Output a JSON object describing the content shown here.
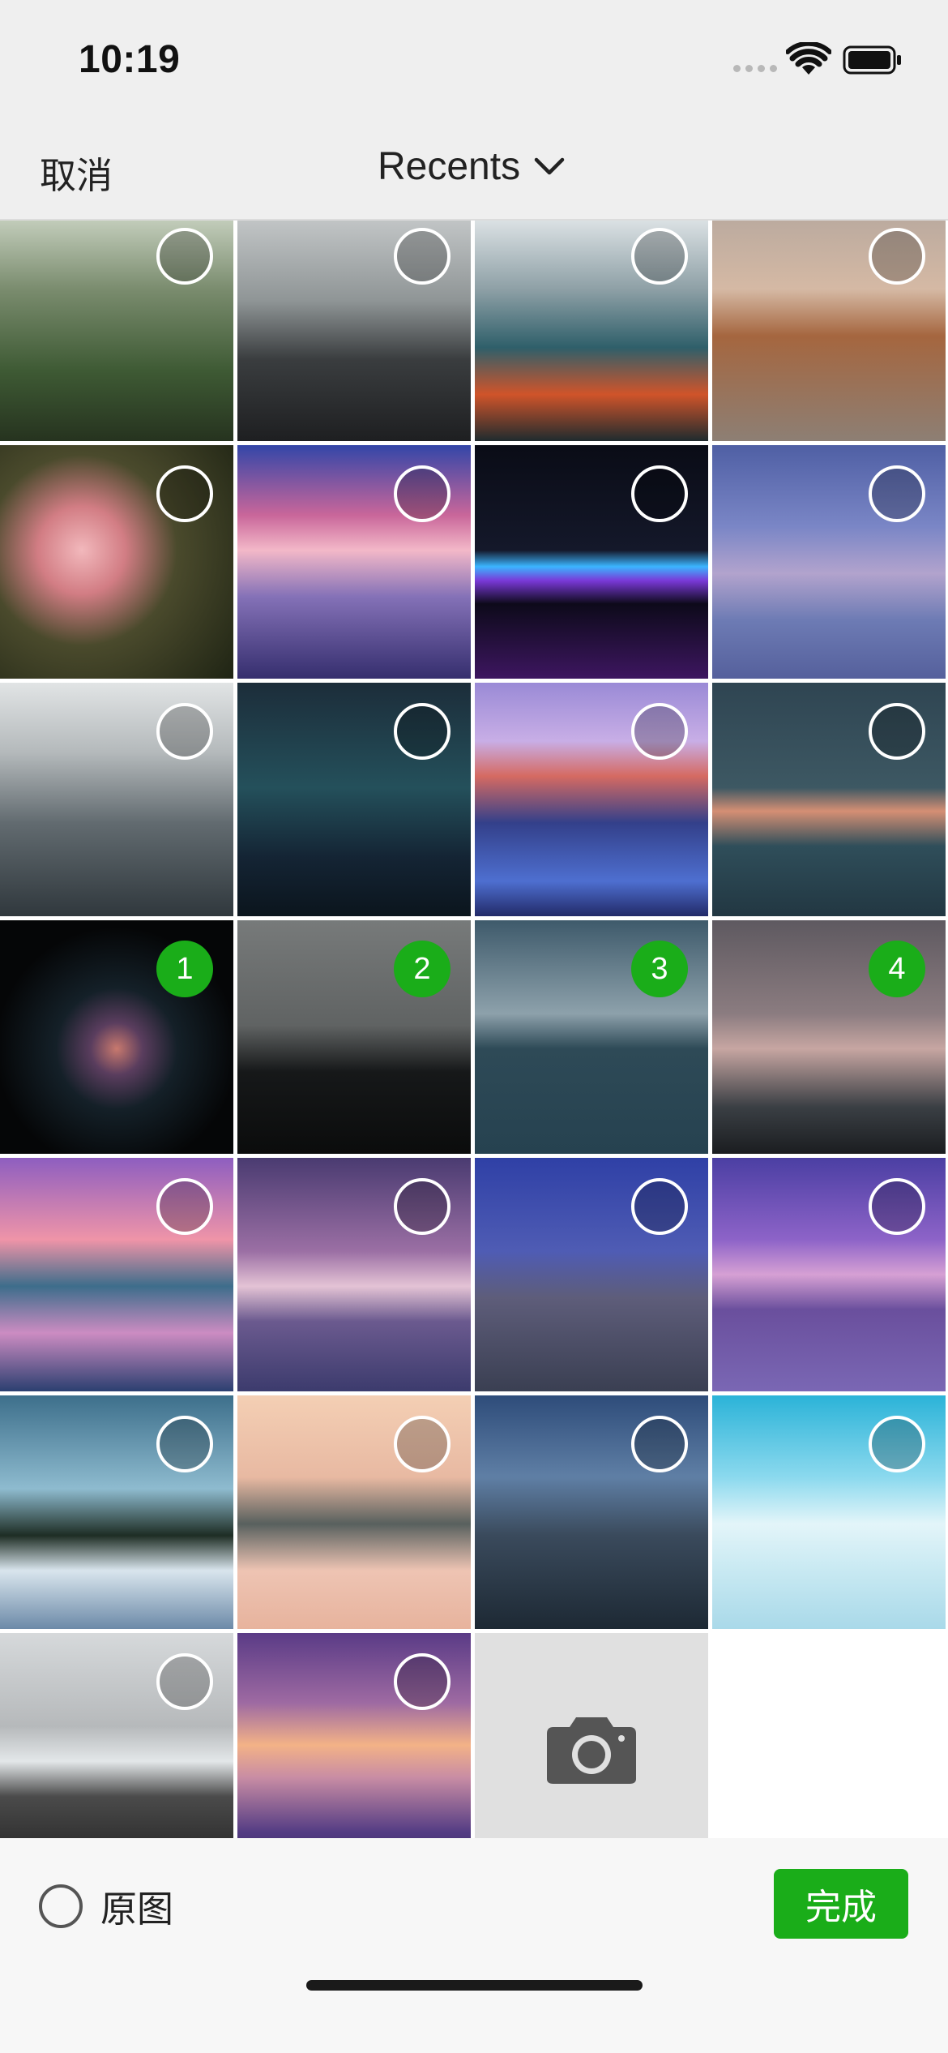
{
  "status_bar": {
    "time": "10:19"
  },
  "nav": {
    "cancel_label": "取消",
    "album_title": "Recents",
    "dropdown_icon": "chevron-down-icon"
  },
  "photos": [
    {
      "name": "forest-sunrays",
      "bg": "linear-gradient(180deg,#cfd8c8 0%,#7a8c6e 35%,#3e5a34 70%,#26331f 100%)",
      "selected": null
    },
    {
      "name": "black-beach-seastacks",
      "bg": "linear-gradient(180deg,#c9cccd 0%,#8f9596 40%,#3a3d3f 65%,#1e1f21 100%)",
      "selected": null
    },
    {
      "name": "moraine-lake-canoes",
      "bg": "linear-gradient(180deg,#e9edef 0%,#8ea0a6 35%,#2f5f6a 60%,#d0542a 80%,#1f2b2e 100%)",
      "selected": null
    },
    {
      "name": "misty-lake-autumn",
      "bg": "linear-gradient(180deg,#b7a89e 0%,#d5b9a4 35%,#a5663f 55%,#8d7f74 100%)",
      "selected": null
    },
    {
      "name": "pink-rose",
      "bg": "radial-gradient(circle at 35% 45%,#f2b8bc 0%,#d27d84 22%,#4a4a2c 48%,#1f2414 100%)",
      "selected": null
    },
    {
      "name": "boat-pink-sunset",
      "bg": "linear-gradient(180deg,#3346a8 0%,#c9669a 30%,#f3b8c8 45%,#8471b7 65%,#352e6e 100%)",
      "selected": null
    },
    {
      "name": "dark-keyboard-glow",
      "bg": "linear-gradient(180deg,#0a0c16 0%,#14182a 45%,#3bb5ff 52%,#7a39d8 58%,#0d0a1a 68%,#3d1660 100%)",
      "selected": null
    },
    {
      "name": "blue-horizon-blur",
      "bg": "linear-gradient(180deg,#4f5fa4 0%,#7a86c6 35%,#b2a3cd 55%,#6d7bb4 75%,#55609c 100%)",
      "selected": null
    },
    {
      "name": "misty-pine-forest",
      "bg": "linear-gradient(180deg,#e1e4e5 0%,#b4b9bb 30%,#626b70 60%,#30383d 100%)",
      "selected": null
    },
    {
      "name": "aurora-night",
      "bg": "linear-gradient(180deg,#1c2d3a 0%,#24505b 45%,#142434 75%,#0b151d 100%)",
      "selected": null
    },
    {
      "name": "yosemite-el-capitan",
      "bg": "linear-gradient(180deg,#9a8ad6 0%,#c8aee6 25%,#d56a62 40%,#33408a 60%,#4e6fd0 85%,#222a68 100%)",
      "selected": null
    },
    {
      "name": "dusk-dunes",
      "bg": "linear-gradient(180deg,#2f4552 0%,#3d5863 45%,#d58f74 55%,#2f4e5a 70%,#223742 100%)",
      "selected": null
    },
    {
      "name": "laptop-dark",
      "bg": "radial-gradient(circle at 50% 55%,#c8796e 0%,#5a3d5e 15%,#142028 35%,#050607 70%)",
      "selected": 1
    },
    {
      "name": "pine-silhouette",
      "bg": "linear-gradient(180deg,#777a7a 0%,#606363 45%,#161819 65%,#0b0c0c 100%)",
      "selected": 2
    },
    {
      "name": "mountain-reflection",
      "bg": "linear-gradient(180deg,#3e5a6b 0%,#8da1ab 40%,#2e4a57 55%,#264250 100%)",
      "selected": 3
    },
    {
      "name": "above-the-clouds",
      "bg": "linear-gradient(180deg,#5e5960 0%,#8b7c80 40%,#c7a6a2 55%,#3a3f44 80%,#1b1d20 100%)",
      "selected": 4
    },
    {
      "name": "palm-island-sunset",
      "bg": "linear-gradient(180deg,#8e5ec0 0%,#ef94a8 35%,#3d6d8b 55%,#cc8cc2 75%,#2b3f70 100%)",
      "selected": null
    },
    {
      "name": "pink-mountain-lake",
      "bg": "linear-gradient(180deg,#4a3b71 0%,#9b6fa4 40%,#e4c3d5 55%,#6b5a8f 70%,#3c3b6d 100%)",
      "selected": null
    },
    {
      "name": "half-dome-dusk",
      "bg": "linear-gradient(180deg,#2f40a6 0%,#4f5cb4 40%,#5e5d7a 60%,#3a3f52 100%)",
      "selected": null
    },
    {
      "name": "purple-sea-blur",
      "bg": "linear-gradient(180deg,#4b3fa3 0%,#8d63c8 35%,#d6a0d4 50%,#6a4f9d 65%,#7a67b4 100%)",
      "selected": null
    },
    {
      "name": "snowy-village-field",
      "bg": "linear-gradient(180deg,#3d6f8b 0%,#8ebbcf 40%,#1e2d24 60%,#d9e5ed 75%,#6c8aa8 100%)",
      "selected": null
    },
    {
      "name": "foggy-village-peach",
      "bg": "linear-gradient(180deg,#f4cfb4 0%,#e8b9a2 35%,#58605e 55%,#eec4b3 75%,#e7b39d 100%)",
      "selected": null
    },
    {
      "name": "yosemite-cliffs-night",
      "bg": "linear-gradient(180deg,#2e4c7a 0%,#5f7fa5 35%,#3a4a5c 60%,#1d2934 100%)",
      "selected": null
    },
    {
      "name": "snow-dunes-cyan",
      "bg": "linear-gradient(180deg,#2bb3d8 0%,#8bd9ee 35%,#e3f5f9 55%,#c8e9f2 75%,#a9d9e9 100%)",
      "selected": null
    },
    {
      "name": "foggy-black-beach",
      "bg": "linear-gradient(180deg,#d6d9db 0%,#b6b9bb 40%,#e3e7e9 55%,#4b4b4b 70%,#232323 100%)",
      "selected": null
    },
    {
      "name": "violet-calm-sunset",
      "bg": "linear-gradient(180deg,#5a3b86 0%,#9e6aa2 30%,#f3b287 48%,#c88ca4 62%,#553d84 85%,#2e2360 100%)",
      "selected": null
    }
  ],
  "camera_tile": {
    "icon": "camera-icon"
  },
  "toolbar": {
    "original_label": "原图",
    "done_label": "完成"
  },
  "colors": {
    "accent": "#1aad19",
    "nav_bg": "#efefef",
    "toolbar_bg": "#f7f7f7"
  }
}
